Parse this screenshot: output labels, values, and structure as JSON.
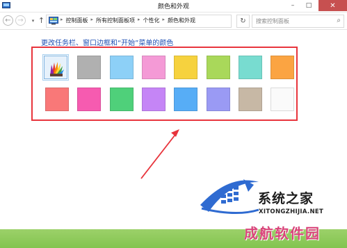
{
  "window": {
    "title": "颜色和外观",
    "min_glyph": "–",
    "max_glyph": "□",
    "close_glyph": "✕"
  },
  "nav": {
    "back_glyph": "←",
    "forward_glyph": "→",
    "recent_glyph": "▾",
    "up_glyph": "↑",
    "refresh_glyph": "↻",
    "dropdown_glyph": "▾",
    "breadcrumbs": [
      "控制面板",
      "所有控制面板项",
      "个性化",
      "颜色和外观"
    ],
    "crumb_separator": "▸",
    "search_placeholder": "搜索控制面板",
    "search_glyph": "⌕"
  },
  "content": {
    "heading": "更改任务栏、窗口边框和“开始”菜单的颜色",
    "colors_row1": [
      "custom-color-mixer",
      "#b0b0b0",
      "#8dd0f7",
      "#f49ad6",
      "#f6d23e",
      "#a9d85a",
      "#78dcd0",
      "#fba442"
    ],
    "colors_row2": [
      "#f97878",
      "#f65bb0",
      "#4fd07a",
      "#c585f6",
      "#57adf6",
      "#9a9af4",
      "#c7b8a5",
      "#fafafa"
    ],
    "highlight_color": "#e8343c"
  },
  "watermark": {
    "brand": "系统之家",
    "url": "XITONGZHIJIA.NET",
    "stamp": "成航软件园"
  }
}
